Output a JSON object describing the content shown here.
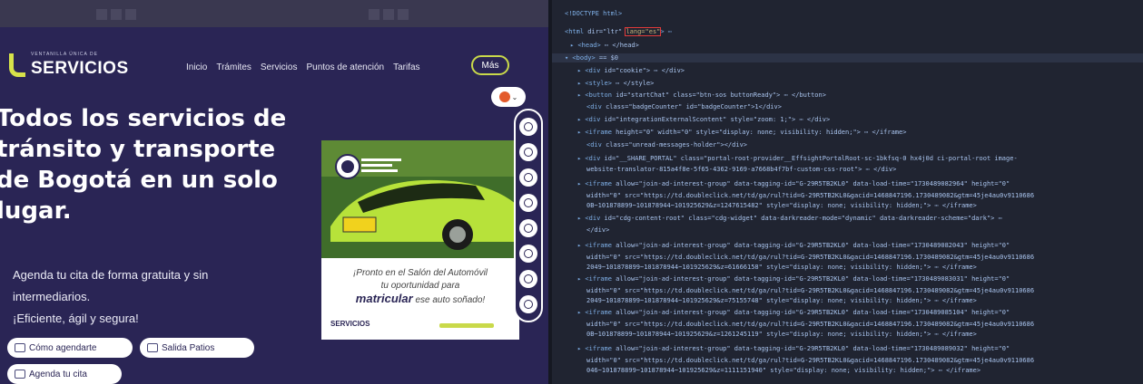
{
  "site": {
    "logo_small": "VENTANILLA ÚNICA DE",
    "logo_big": "SERVICIOS",
    "nav": [
      "Inicio",
      "Trámites",
      "Servicios",
      "Puntos de atención",
      "Tarifas"
    ],
    "nav_more": "Más",
    "hero_lines": [
      "Todos los servicios de",
      "tránsito y transporte",
      "de Bogotá en un solo",
      "lugar."
    ],
    "hero_copy": [
      "Agenda tu cita de forma gratuita y sin",
      "intermediarios.",
      "¡Eficiente, ágil y segura!"
    ],
    "buttons": [
      "Cómo agendarte",
      "Salida Patios",
      "Agenda tu cita"
    ],
    "ad": {
      "caption_1": "¡Pronto en el Salón del Automóvil",
      "caption_2": "tu oportunidad para",
      "caption_bold": "matricular",
      "caption_3": "ese auto soñado!",
      "footer_logo": "SERVICIOS"
    },
    "a11y_buttons": 8,
    "colors": {
      "brand": "#2a2555",
      "accent": "#c9d94a"
    }
  },
  "devtools": {
    "lines": [
      {
        "tag": "<!DOCTYPE html>",
        "attrs": ""
      },
      {
        "tag": "<html",
        "attrs": " dir=\"ltr\" ",
        "highlight": "lang=\"es\"",
        "tail": "> ⋯ "
      },
      {
        "tag": "▸ <head>",
        "attrs": " ⋯ </head>"
      },
      {
        "tag": "▾ <body>",
        "attrs": " == $0"
      },
      {
        "tag": "▸ <div",
        "attrs": " id=\"cookie\"> ⋯ </div>"
      },
      {
        "tag": "▸ <style>",
        "attrs": " ⋯ </style>"
      },
      {
        "tag": "▸ <button",
        "attrs": " id=\"startChat\" class=\"btn-sos buttonReady\"> ⋯ </button>"
      },
      {
        "tag": "<div",
        "attrs": " class=\"badgeCounter\" id=\"badgeCounter\">1</div>"
      },
      {
        "tag": "▸ <div",
        "attrs": " id=\"integrationExternalScontent\" style=\"zoom: 1;\"> ⋯ </div>"
      },
      {
        "tag": "▸ <iframe",
        "attrs": " height=\"0\" width=\"0\" style=\"display: none; visibility: hidden;\"> ⋯ </iframe>"
      },
      {
        "tag": "<div",
        "attrs": " class=\"unread-messages-holder\"></div>"
      },
      {
        "tag": "▸ <div",
        "attrs": " id=\"__SHARE_PORTAL\" class=\"portal-root-provider__EffsightPortalRoot-sc-1bkfsq-0 hx4j0d ci-portal-root image-"
      },
      {
        "tag": "",
        "attrs": "website-translator-815a4f8e-5f65-4362-9169-a7668b4f7bf-custom-css-root\"> ⋯ </div>"
      },
      {
        "tag": "▸ <iframe",
        "attrs": " allow=\"join-ad-interest-group\" data-tagging-id=\"G-29R5TB2KL0\" data-load-time=\"1730489082964\" height=\"0\""
      },
      {
        "tag": "",
        "attrs": "width=\"0\" src=\"https://td.doubleclick.net/td/ga/rul?tid=G-29R5TB2KL0&gacid=1468847196.1730489082&gtm=45je4au0v9110686"
      },
      {
        "tag": "",
        "attrs": "0B~101878899~101878944~101925629&z=1247615482\" style=\"display: none; visibility: hidden;\"> ⋯ </iframe>"
      },
      {
        "tag": "▸ <div",
        "attrs": " id=\"cdg-content-root\" class=\"cdg-widget\" data-darkreader-mode=\"dynamic\" data-darkreader-scheme=\"dark\"> ⋯"
      },
      {
        "tag": "",
        "attrs": "</div>"
      },
      {
        "tag": "▸ <iframe",
        "attrs": " allow=\"join-ad-interest-group\" data-tagging-id=\"G-29R5TB2KL0\" data-load-time=\"1730489082043\" height=\"0\""
      },
      {
        "tag": "",
        "attrs": "width=\"0\" src=\"https://td.doubleclick.net/td/ga/rul?tid=G-29R5TB2KL0&gacid=1468847196.1730489082&gtm=45je4au0v9110686"
      },
      {
        "tag": "",
        "attrs": "2049~101878899~101878944~101925629&z=61666158\" style=\"display: none; visibility: hidden;\"> ⋯ </iframe>"
      },
      {
        "tag": "▸ <iframe",
        "attrs": " allow=\"join-ad-interest-group\" data-tagging-id=\"G-29R5TB2KL0\" data-load-time=\"1730489083031\" height=\"0\""
      },
      {
        "tag": "",
        "attrs": "width=\"0\" src=\"https://td.doubleclick.net/td/ga/rul?tid=G-29R5TB2KL0&gacid=1468847196.1730489082&gtm=45je4au0v9110686"
      },
      {
        "tag": "",
        "attrs": "2049~101878899~101878944~101925629&z=75155748\" style=\"display: none; visibility: hidden;\"> ⋯ </iframe>"
      },
      {
        "tag": "▸ <iframe",
        "attrs": " allow=\"join-ad-interest-group\" data-tagging-id=\"G-29R5TB2KL0\" data-load-time=\"1730489085104\" height=\"0\""
      },
      {
        "tag": "",
        "attrs": "width=\"0\" src=\"https://td.doubleclick.net/td/ga/rul?tid=G-29R5TB2KL0&gacid=1468847196.1730489082&gtm=45je4au0v9110686"
      },
      {
        "tag": "",
        "attrs": "0B~101878899~101878944~101925629&z=1261245119\" style=\"display: none; visibility: hidden;\"> ⋯ </iframe>"
      },
      {
        "tag": "▸ <iframe",
        "attrs": " allow=\"join-ad-interest-group\" data-tagging-id=\"G-29R5TB2KL0\" data-load-time=\"1730489089032\" height=\"0\""
      },
      {
        "tag": "",
        "attrs": "width=\"0\" src=\"https://td.doubleclick.net/td/ga/rul?tid=G-29R5TB2KL0&gacid=1468847196.1730489082&gtm=45je4au0v9110686"
      },
      {
        "tag": "",
        "attrs": "046~101878899~101878944~101925629&z=1111151940\" style=\"display: none; visibility: hidden;\"> ⋯ </iframe>"
      }
    ]
  }
}
